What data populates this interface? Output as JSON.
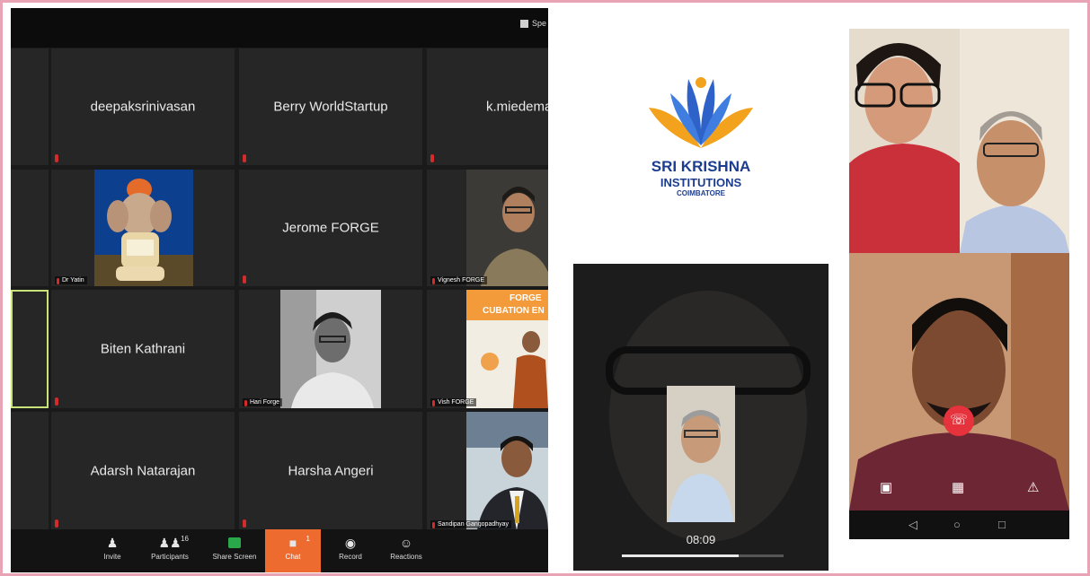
{
  "zoom": {
    "speaker_view_label": "Spe",
    "tiles": [
      {
        "name": "deepaksrinivasan"
      },
      {
        "name": "Berry WorldStartup"
      },
      {
        "name": "k.miedema"
      },
      {
        "label": "Dr Yatin"
      },
      {
        "name": "Jerome FORGE"
      },
      {
        "label": "Vignesh FORGE"
      },
      {
        "name": "Biten Kathrani"
      },
      {
        "label": "Hari Forge"
      },
      {
        "label": "Vish FORGE",
        "banner": "FORGE",
        "banner2": "CUBATION EN"
      },
      {
        "name": "Adarsh Natarajan"
      },
      {
        "name": "Harsha Angeri"
      },
      {
        "label": "Sandipan Gangopadhyay"
      }
    ],
    "toolbar": {
      "invite": "Invite",
      "participants": "Participants",
      "participants_count": "16",
      "share": "Share Screen",
      "chat": "Chat",
      "chat_count": "1",
      "record": "Record",
      "reactions": "Reactions"
    },
    "colors": {
      "chat_active": "#ee6b2f",
      "share_icon": "#2aa94b",
      "mic_muted": "#d62b2b"
    }
  },
  "logo": {
    "line1": "SRI KRISHNA",
    "line2": "INSTITUTIONS",
    "line3": "COIMBATORE",
    "colors": {
      "text": "#1c3d8f",
      "petal_orange": "#f2a21c",
      "petal_blue": "#2e62c9"
    }
  },
  "call1": {
    "time": "08:09",
    "progress": 0.72
  },
  "call2": {
    "end_color": "#e5323c",
    "icons": [
      "camera-icon",
      "video-off-icon",
      "mic-off-icon",
      "end-call-icon"
    ]
  }
}
